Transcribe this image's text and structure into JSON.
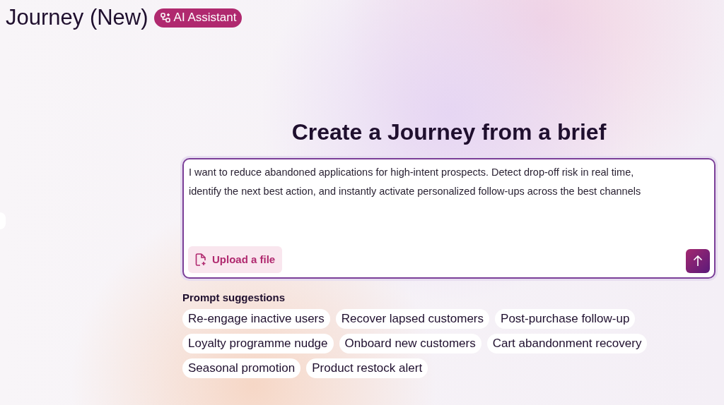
{
  "page": {
    "title": "Journey (New)",
    "badge": "AI Assistant"
  },
  "composer": {
    "heading": "Create a Journey from a brief",
    "value": "I want to reduce abandoned applications for high-intent prospects. Detect drop-off risk in real time, identify the next best action, and instantly activate personalized follow-ups across the best channels",
    "upload_label": "Upload a file"
  },
  "suggestions": {
    "label": "Prompt suggestions",
    "items": [
      "Re-engage inactive users",
      "Recover lapsed customers",
      "Post-purchase follow-up",
      "Loyalty programme nudge",
      "Onboard new customers",
      "Cart abandonment recovery",
      "Seasonal promotion",
      "Product restock alert"
    ]
  }
}
